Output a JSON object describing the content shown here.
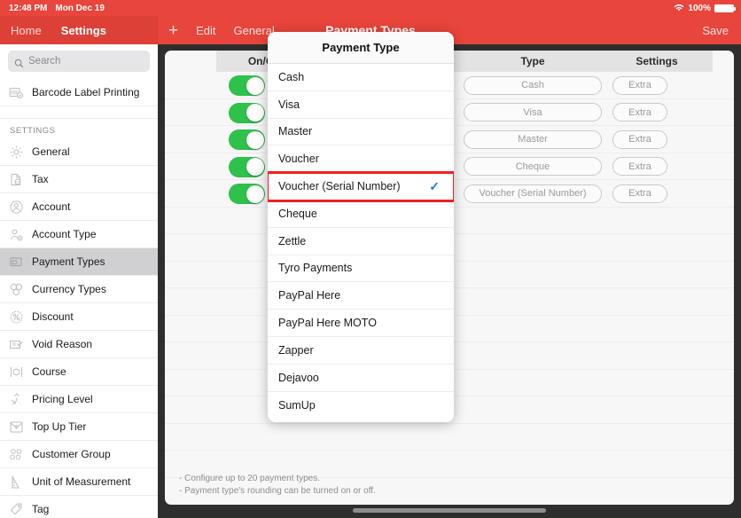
{
  "statusbar": {
    "time": "12:48 PM",
    "date": "Mon Dec 19",
    "wifi_icon": "wifi-icon",
    "battery_percent": "100%",
    "battery_icon": "battery-full-icon"
  },
  "navbar": {
    "home_label": "Home",
    "settings_label": "Settings",
    "add_icon": "plus-icon",
    "edit_label": "Edit",
    "general_label": "General",
    "title": "Payment Types",
    "save_label": "Save"
  },
  "sidebar": {
    "search_placeholder": "Search",
    "search_icon": "search-icon",
    "top_items": [
      {
        "label": "Barcode Label Printing",
        "icon": "barcode-label-icon"
      }
    ],
    "section_header": "SETTINGS",
    "items": [
      {
        "label": "General",
        "icon": "gear-icon"
      },
      {
        "label": "Tax",
        "icon": "tax-document-icon"
      },
      {
        "label": "Account",
        "icon": "person-circle-icon"
      },
      {
        "label": "Account Type",
        "icon": "person-gear-icon"
      },
      {
        "label": "Payment Types",
        "icon": "credit-card-icon",
        "selected": true
      },
      {
        "label": "Currency Types",
        "icon": "coins-icon"
      },
      {
        "label": "Discount",
        "icon": "percent-badge-icon"
      },
      {
        "label": "Void Reason",
        "icon": "note-check-icon"
      },
      {
        "label": "Course",
        "icon": "cutlery-icon"
      },
      {
        "label": "Pricing Level",
        "icon": "price-arrow-icon"
      },
      {
        "label": "Top Up Tier",
        "icon": "envelope-dollar-icon"
      },
      {
        "label": "Customer Group",
        "icon": "people-group-icon"
      },
      {
        "label": "Unit of Measurement",
        "icon": "ruler-icon"
      },
      {
        "label": "Tag",
        "icon": "tag-icon"
      }
    ]
  },
  "table": {
    "columns": [
      "On/Off",
      "Type",
      "Settings"
    ],
    "rows": [
      {
        "on": true,
        "type": "Cash",
        "settings": "Extra"
      },
      {
        "on": true,
        "type": "Visa",
        "settings": "Extra"
      },
      {
        "on": true,
        "type": "Master",
        "settings": "Extra"
      },
      {
        "on": true,
        "type": "Cheque",
        "settings": "Extra"
      },
      {
        "on": true,
        "type": "Voucher (Serial Number)",
        "settings": "Extra"
      }
    ],
    "empty_row_count": 10
  },
  "footer_note": {
    "line1": "- Configure up to 20 payment types.",
    "line2": "- Payment type's rounding can be turned on or off."
  },
  "modal": {
    "title": "Payment Type",
    "checkmark_icon": "checkmark-icon",
    "options": [
      {
        "label": "Cash"
      },
      {
        "label": "Visa"
      },
      {
        "label": "Master"
      },
      {
        "label": "Voucher"
      },
      {
        "label": "Voucher (Serial Number)",
        "selected": true,
        "highlighted": true
      },
      {
        "label": "Cheque"
      },
      {
        "label": "Zettle"
      },
      {
        "label": "Tyro Payments"
      },
      {
        "label": "PayPal Here"
      },
      {
        "label": "PayPal Here MOTO"
      },
      {
        "label": "Zapper"
      },
      {
        "label": "Dejavoo"
      },
      {
        "label": "SumUp"
      }
    ]
  },
  "colors": {
    "brand_red": "#e8453c",
    "toggle_green": "#2ec24b",
    "highlight_red": "#f51f1f",
    "check_blue": "#1a7cf0",
    "frame_dark": "#2e2e2e"
  }
}
